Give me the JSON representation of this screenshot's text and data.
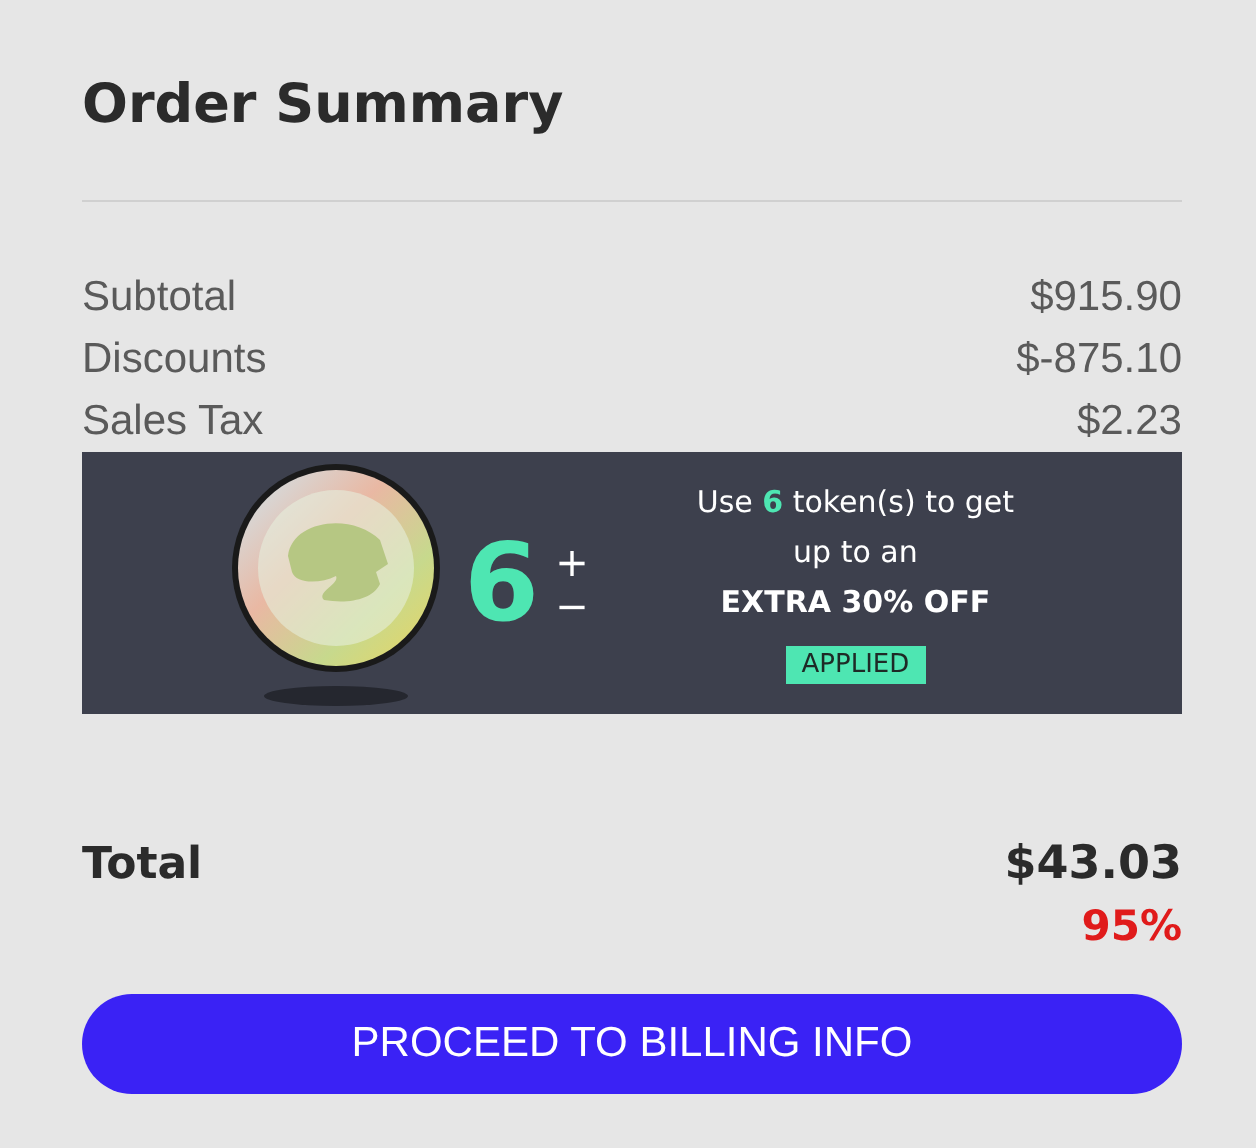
{
  "title": "Order Summary",
  "lines": [
    {
      "label": "Subtotal",
      "value": "$915.90"
    },
    {
      "label": "Discounts",
      "value": "$-875.10"
    },
    {
      "label": "Sales Tax",
      "value": "$2.23"
    }
  ],
  "tokens": {
    "count": "6",
    "plus": "+",
    "minus": "−",
    "offer_line_1": "Use **6** token(s) to get",
    "offer_line_2": "up to an",
    "offer_line_3": "EXTRA 30% OFF",
    "status": "APPLIED",
    "applied": true
  },
  "total": {
    "label": "Total",
    "value": "$43.03",
    "percent": "95%"
  },
  "button": "PROCEED TO BILLING INFO"
}
